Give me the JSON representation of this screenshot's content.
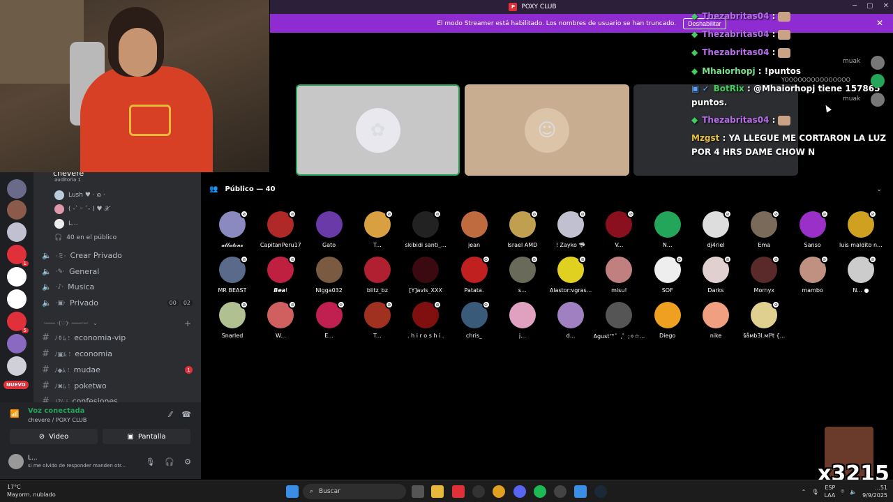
{
  "window": {
    "app_title": "POXY CLUB",
    "controls": [
      "─",
      "▢",
      "✕"
    ]
  },
  "banner": {
    "message": "El modo Streamer está habilitado. Los nombres de usuario se han truncado.",
    "button": "Deshabilitar"
  },
  "chat": {
    "lines": [
      {
        "name": "Thezabritas04",
        "text": " :"
      },
      {
        "name": "Thezabritas04",
        "text": " :"
      },
      {
        "name": "Thezabritas04",
        "text": " :"
      },
      {
        "name": "Mhaiorhopj",
        "text": " : !puntos"
      },
      {
        "name": "BotRix",
        "text": " : @Mhaiorhopj tiene 157865"
      },
      {
        "name": "",
        "text": "puntos."
      },
      {
        "name": "Thezabritas04",
        "text": " :"
      },
      {
        "name": "Mzgst",
        "text": " : YA LLEGUE ME CORTARON LA LUZ"
      },
      {
        "name": "",
        "text": "POR 4 HRS DAME CHOW N"
      }
    ],
    "side": {
      "msg1": "muak",
      "msg2": "YOOOOOOOOOOOOOOO",
      "msg3": "muak"
    }
  },
  "sidebar": {
    "top_channel": "chevere",
    "top_channel_sub": "auditoria 1",
    "users": [
      "Lush ♥ · ɷ ·",
      "( -ˋ ᵕ ˊ- ) ♥ 𝒳",
      "L..."
    ],
    "audience_count": "40 en el público",
    "voice_channels": [
      {
        "icon": "·ミ·",
        "name": "Crear Privado"
      },
      {
        "icon": "·✎·",
        "name": "General"
      },
      {
        "icon": "·♪·",
        "name": "Musica"
      },
      {
        "icon": "·▣·",
        "name": "Privado",
        "counts": [
          "00",
          "02"
        ]
      }
    ],
    "category": "·─── ·(♡)· ───·─·",
    "text_channels": [
      {
        "name": "economia-vip"
      },
      {
        "name": "economia"
      },
      {
        "name": "mudae",
        "unread": "1"
      },
      {
        "name": "poketwo"
      },
      {
        "name": "confesiones"
      }
    ],
    "new_badge": "NUEVO"
  },
  "voice_panel": {
    "status": "Voz conectada",
    "where": "chevere / POXY CLUB",
    "video_label": "Video",
    "screen_label": "Pantalla",
    "user_name": "L...",
    "user_status": "si me olvido de responder manden otr..."
  },
  "audience": {
    "title": "Público — 40",
    "members": [
      {
        "name": "𝓪𝓵𝓵𝓪𝓽𝓸𝓷𝓮",
        "color": "#8a8ac0"
      },
      {
        "name": "CapitanPeru17",
        "color": "#b02828"
      },
      {
        "name": "Gato",
        "color": "#6a3aa8"
      },
      {
        "name": "T...",
        "color": "#d8a040"
      },
      {
        "name": "skibidi santi_...",
        "color": "#222"
      },
      {
        "name": "jean",
        "color": "#c06a40"
      },
      {
        "name": "Israel AMD",
        "color": "#c0a050"
      },
      {
        "name": "! Zayko 🦈",
        "color": "#c0c0d0"
      },
      {
        "name": "V...",
        "color": "#8a1020"
      },
      {
        "name": "N...",
        "color": "#23a55a"
      },
      {
        "name": "dj4riel",
        "color": "#ddd"
      },
      {
        "name": "Ema",
        "color": "#7a6a5a"
      },
      {
        "name": "Sanso",
        "color": "#9a30c8"
      },
      {
        "name": "luis maldito n...",
        "color": "#d0a020"
      },
      {
        "name": "MR BEAST",
        "color": "#5a6a8a"
      },
      {
        "name": "𝘽𝙚𝙖!",
        "color": "#c02040"
      },
      {
        "name": "Nigga032",
        "color": "#7a5a40"
      },
      {
        "name": "blitz_bz",
        "color": "#b02030"
      },
      {
        "name": "[Y]avis_XXX",
        "color": "#3a0a10"
      },
      {
        "name": "Patata.",
        "color": "#c02020"
      },
      {
        "name": "s...",
        "color": "#6a6a5a"
      },
      {
        "name": "Alastor:vgras...",
        "color": "#e0d020"
      },
      {
        "name": "misu!",
        "color": "#c08080"
      },
      {
        "name": "SOF",
        "color": "#eee"
      },
      {
        "name": "Darks",
        "color": "#e0d0d0"
      },
      {
        "name": "Mornyx",
        "color": "#5a2a2a"
      },
      {
        "name": "mambo",
        "color": "#c09080"
      },
      {
        "name": "N... ●",
        "color": "#ccc"
      },
      {
        "name": "Snarled",
        "color": "#b0c090"
      },
      {
        "name": "W...",
        "color": "#d06060"
      },
      {
        "name": "E...",
        "color": "#c02050"
      },
      {
        "name": "T...",
        "color": "#a03020"
      },
      {
        "name": ". h i r o s h i .",
        "color": "#801010"
      },
      {
        "name": "chris_",
        "color": "#3a5a7a"
      },
      {
        "name": "j...",
        "color": "#e0a0c0"
      },
      {
        "name": "d...",
        "color": "#a080c0"
      },
      {
        "name": "Agust™゛,゛;✧☆...",
        "color": "#555"
      },
      {
        "name": "Diego",
        "color": "#f0a020"
      },
      {
        "name": "nike",
        "color": "#f0a080"
      },
      {
        "name": "§åмb3l.мℙ𝗍 {...",
        "color": "#e0d090"
      }
    ]
  },
  "taskbar": {
    "weather_temp": "17°C",
    "weather_desc": "Mayorm. nublado",
    "search_placeholder": "Buscar",
    "lang": "ESP",
    "lang2": "LAA",
    "time": "...51",
    "date": "9/9/2025"
  },
  "overlay": {
    "counter": "x3215"
  }
}
